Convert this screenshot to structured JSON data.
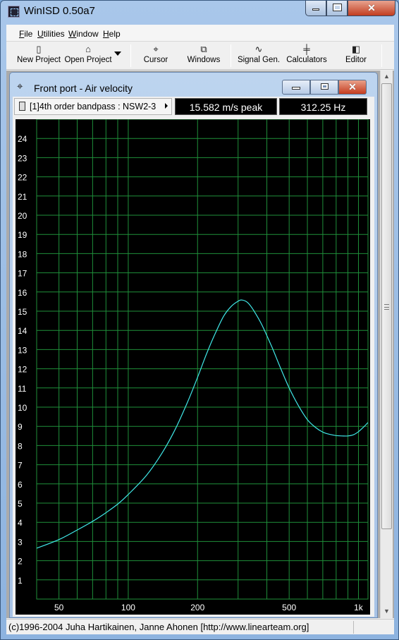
{
  "window": {
    "title": "WinISD 0.50a7",
    "minimize": "minimize",
    "maximize": "maximize",
    "close": "close"
  },
  "menu": [
    {
      "label": "File",
      "accel": "F",
      "rest": "ile"
    },
    {
      "label": "Utilities",
      "accel": "U",
      "rest": "tilities"
    },
    {
      "label": "Window",
      "accel": "W",
      "rest": "indow"
    },
    {
      "label": "Help",
      "accel": "H",
      "rest": "elp"
    }
  ],
  "toolbar": {
    "new_project": "New Project",
    "open_project": "Open Project",
    "cursor": "Cursor",
    "windows": "Windows",
    "signal_gen": "Signal Gen.",
    "calculators": "Calculators",
    "editor": "Editor"
  },
  "child_window": {
    "title": "Front port - Air velocity",
    "project": "[1]4th order bandpass : NSW2-3",
    "peak_readout": "15.582 m/s peak",
    "freq_readout": "312.25 Hz"
  },
  "status": {
    "text": "(c)1996-2004 Juha Hartikainen, Janne Ahonen [http://www.linearteam.org]"
  },
  "colors": {
    "plot_bg": "#000000",
    "grid": "#1f8f3a",
    "curve": "#40e8e8",
    "axis_text": "#ffffff"
  },
  "chart_data": {
    "type": "line",
    "xscale": "log",
    "xlim": [
      40,
      1100
    ],
    "ylim": [
      0,
      25
    ],
    "grid": true,
    "x_ticks": [
      {
        "value": 50,
        "label": "50"
      },
      {
        "value": 100,
        "label": "100"
      },
      {
        "value": 200,
        "label": "200"
      },
      {
        "value": 500,
        "label": "500"
      },
      {
        "value": 1000,
        "label": "1k"
      }
    ],
    "x_grid": [
      40,
      50,
      60,
      70,
      80,
      90,
      100,
      200,
      300,
      400,
      500,
      600,
      700,
      800,
      900,
      1000
    ],
    "y_ticks": [
      1,
      2,
      3,
      4,
      5,
      6,
      7,
      8,
      9,
      10,
      11,
      12,
      13,
      14,
      15,
      16,
      17,
      18,
      19,
      20,
      21,
      22,
      23,
      24
    ],
    "series": [
      {
        "x": [
          40,
          50,
          60,
          70,
          80,
          90,
          100,
          120,
          140,
          160,
          180,
          200,
          220,
          240,
          260,
          280,
          300,
          312,
          330,
          350,
          380,
          420,
          460,
          500,
          550,
          600,
          650,
          700,
          750,
          800,
          850,
          900,
          950,
          1000,
          1050,
          1100
        ],
        "y": [
          2.65,
          3.1,
          3.6,
          4.05,
          4.5,
          4.95,
          5.45,
          6.45,
          7.6,
          8.85,
          10.2,
          11.55,
          12.85,
          13.9,
          14.75,
          15.25,
          15.52,
          15.58,
          15.45,
          15.05,
          14.3,
          13.15,
          12.0,
          11.0,
          10.05,
          9.35,
          8.95,
          8.7,
          8.58,
          8.52,
          8.5,
          8.5,
          8.56,
          8.72,
          8.95,
          9.2
        ]
      }
    ]
  }
}
